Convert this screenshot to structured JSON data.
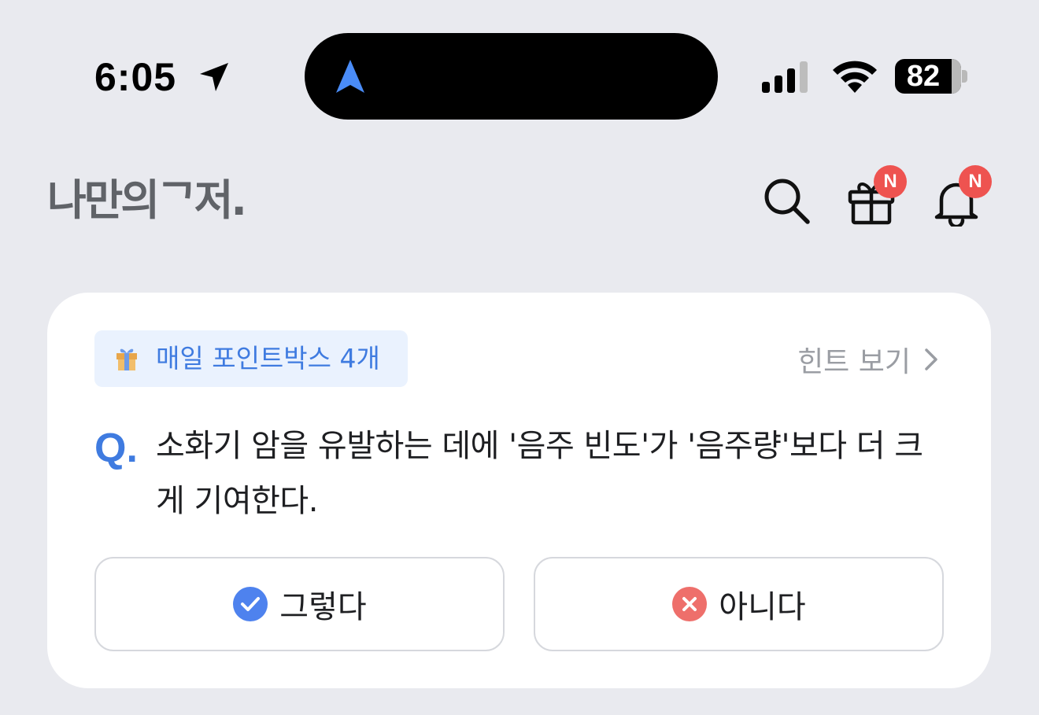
{
  "status_bar": {
    "time": "6:05",
    "battery": "82"
  },
  "header": {
    "logo": "나만의ᄀ저.",
    "badges": {
      "gift": "N",
      "notifications": "N"
    }
  },
  "quiz_card": {
    "points_chip": "매일 포인트박스 4개",
    "hint_label": "힌트 보기",
    "q_marker": "Q.",
    "question": "소화기 암을 유발하는 데에 '음주 빈도'가 '음주량'보다 더 크게 기여한다.",
    "answers": {
      "yes": "그렇다",
      "no": "아니다"
    }
  },
  "colors": {
    "accent": "#3F7BE0",
    "badge": "#EE5350",
    "correct": "#4E82EE",
    "wrong": "#EE6F6B",
    "background": "#E9EAEF"
  },
  "icons": [
    "location-arrow-icon",
    "navigation-icon",
    "signal-icon",
    "wifi-icon",
    "battery-icon",
    "search-icon",
    "gift-icon",
    "bell-icon",
    "gift-box-icon",
    "chevron-right-icon",
    "check-circle-icon",
    "x-circle-icon"
  ]
}
